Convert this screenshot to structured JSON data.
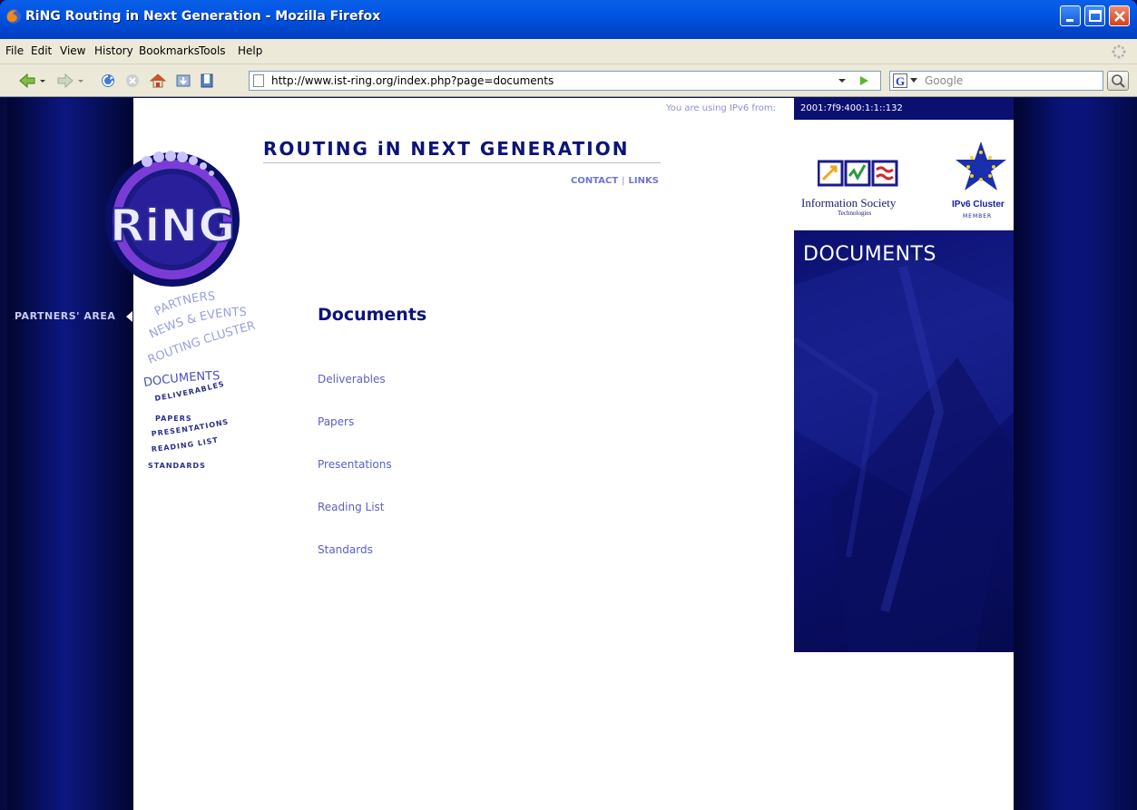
{
  "window": {
    "title": "RiNG Routing in Next Generation - Mozilla Firefox"
  },
  "menu": [
    "File",
    "Edit",
    "View",
    "History",
    "Bookmarks",
    "Tools",
    "Help"
  ],
  "toolbar": {
    "url": "http://www.ist-ring.org/index.php?page=documents",
    "search_placeholder": "Google",
    "search_engine_icon": "G"
  },
  "page": {
    "ipv6_label": "You are using IPv6 from:",
    "ipv6_address": "2001:7f9:400:1:1::132",
    "site_title": "ROUTING iN NEXT GENERATION",
    "top_links": [
      "CONTACT",
      "LINKS"
    ],
    "logo_text": "RiNG",
    "partners_area": "PARTNERS' AREA",
    "nav": {
      "partners": "PARTNERS",
      "news": "NEWS & EVENTS",
      "routing_cluster": "ROUTING CLUSTER",
      "documents": "DOCUMENTS",
      "deliverables": "DELIVERABLES",
      "papers": "PAPERS",
      "presentations": "PRESENTATIONS",
      "reading_list": "READING LIST",
      "standards": "STANDARDS"
    },
    "heading": "Documents",
    "doc_links": [
      "Deliverables",
      "Papers",
      "Presentations",
      "Reading List",
      "Standards"
    ],
    "ist_label": "Information Society",
    "ist_sub": "Technologies",
    "cluster_label": "IPv6 Cluster",
    "cluster_sub": "MEMBER",
    "section_label": "DOCUMENTS"
  },
  "colors": {
    "title_bar": "#0054e3",
    "chrome": "#ece9d8",
    "site_navy": "#0b1070",
    "link": "#5a5fc9"
  }
}
